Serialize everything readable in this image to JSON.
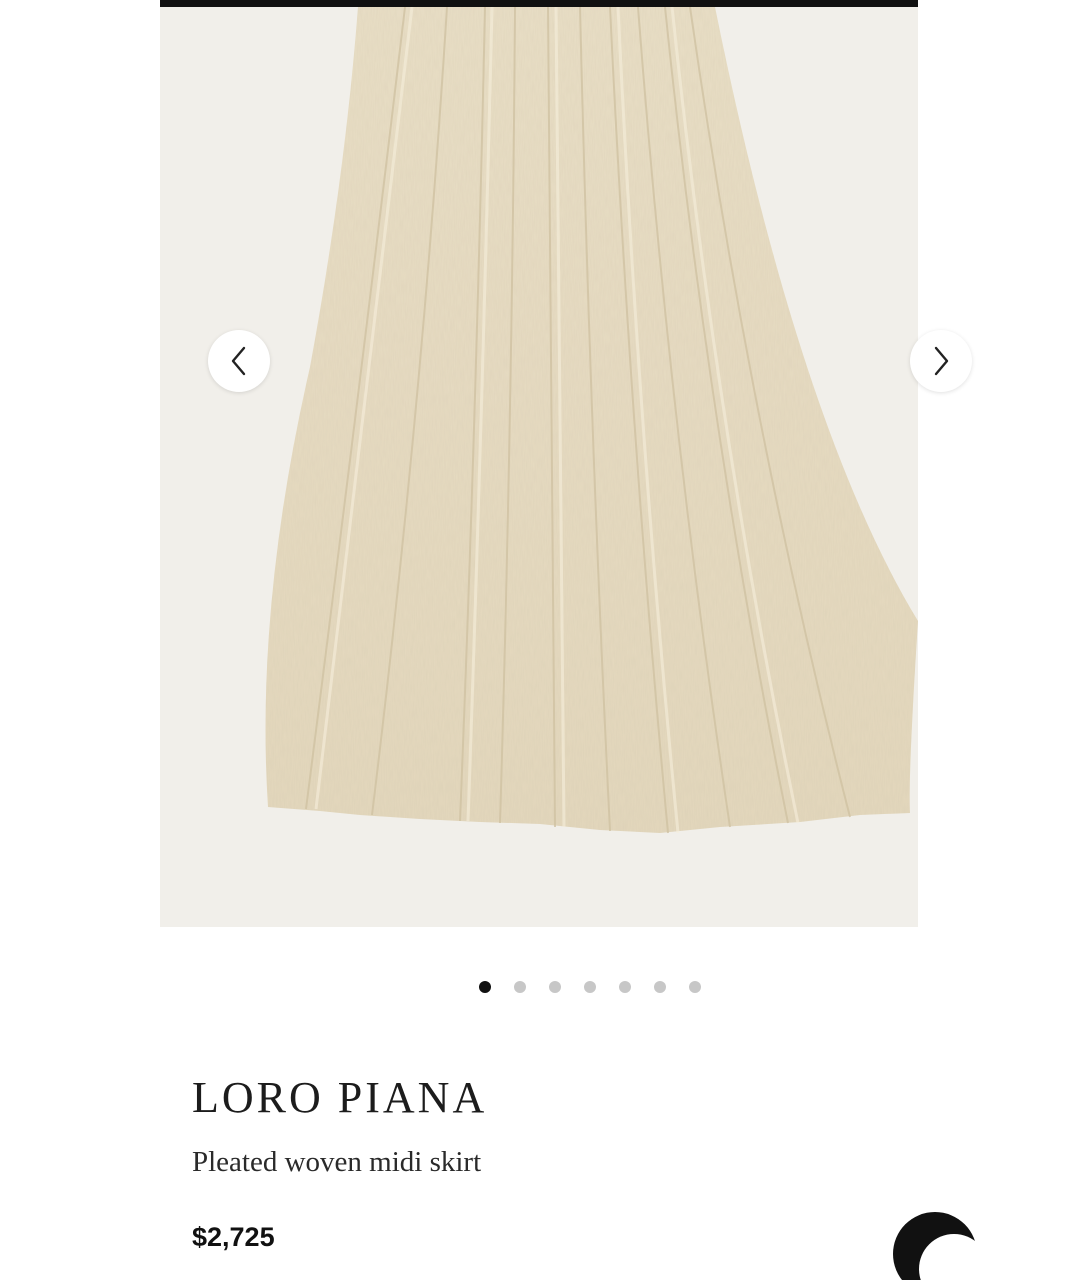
{
  "product": {
    "brand": "LORO PIANA",
    "name": "Pleated woven midi skirt",
    "price": "$2,725"
  },
  "gallery": {
    "image_alt": "Pleated woven midi skirt",
    "image_count": 7,
    "active_index": 0,
    "prev_icon": "chevron-left-icon",
    "next_icon": "chevron-right-icon"
  },
  "colors": {
    "fabric": "#e7dcc1",
    "background": "#f1efea",
    "active_dot": "#111111",
    "inactive_dot": "#c7c7c7"
  }
}
